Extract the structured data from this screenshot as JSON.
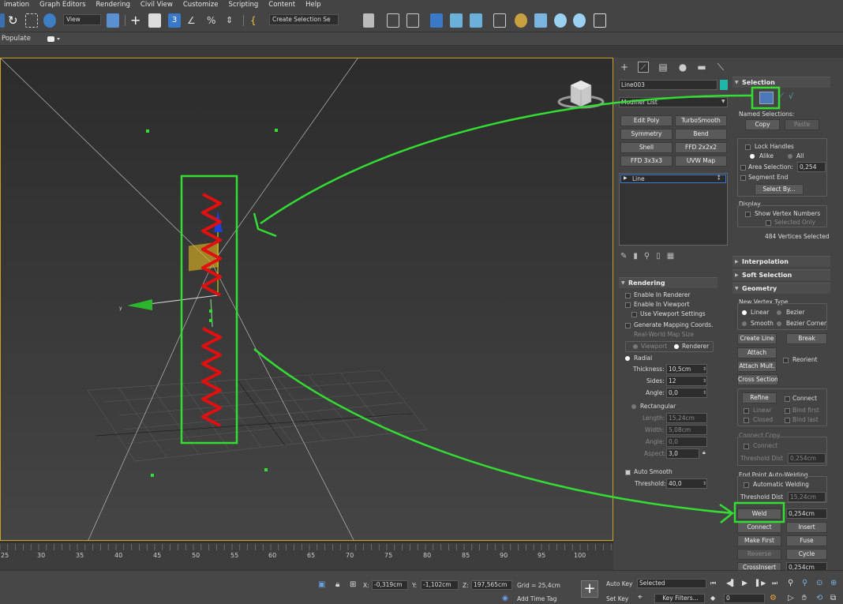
{
  "menu": [
    "imation",
    "Graph Editors",
    "Rendering",
    "Civil View",
    "Customize",
    "Scripting",
    "Content",
    "Help"
  ],
  "toolbar": {
    "view_dropdown": "View",
    "selection_set_dropdown": "Create Selection Se"
  },
  "ribbon": {
    "label": "Populate"
  },
  "object_name": "Line003",
  "modifier_list": {
    "label": "Modifier List",
    "buttons": [
      "Edit Poly",
      "TurboSmooth",
      "Symmetry",
      "Bend",
      "Shell",
      "FFD 2x2x2",
      "FFD 3x3x3",
      "UVW Map"
    ],
    "stack_item": "Line"
  },
  "rendering": {
    "title": "Rendering",
    "enable_renderer": "Enable In Renderer",
    "enable_viewport": "Enable In Viewport",
    "use_viewport": "Use Viewport Settings",
    "gen_mapping": "Generate Mapping Coords.",
    "realworld": "Real-World Map Size",
    "viewport": "Viewport",
    "renderer": "Renderer",
    "radial": "Radial",
    "thickness_label": "Thickness:",
    "thickness": "10,5cm",
    "sides_label": "Sides:",
    "sides": "12",
    "angle_label": "Angle:",
    "angle": "0,0",
    "rectangular": "Rectangular",
    "length_label": "Length:",
    "length": "15,24cm",
    "width_label": "Width:",
    "width": "5,08cm",
    "angle2_label": "Angle:",
    "angle2": "0,0",
    "aspect_label": "Aspect:",
    "aspect": "3,0",
    "auto_smooth": "Auto Smooth",
    "threshold_label": "Threshold:",
    "threshold": "40,0"
  },
  "selection": {
    "title": "Selection",
    "named_selections": "Named Selections:",
    "copy": "Copy",
    "paste": "Paste",
    "lock_handles": "Lock Handles",
    "alike": "Alike",
    "all": "All",
    "area_selection": "Area Selection:",
    "area_value": "0,254",
    "segment_end": "Segment End",
    "select_by": "Select By...",
    "display": "Display",
    "show_vertex_numbers": "Show Vertex Numbers",
    "selected_only": "Selected Only",
    "vertices_selected": "484 Vertices Selected"
  },
  "interpolation": {
    "title": "Interpolation"
  },
  "soft_selection": {
    "title": "Soft Selection"
  },
  "geometry": {
    "title": "Geometry",
    "new_vertex_type": "New Vertex Type",
    "linear": "Linear",
    "bezier": "Bezier",
    "smooth": "Smooth",
    "bezier_corner": "Bezier Corner",
    "create_line": "Create Line",
    "break": "Break",
    "attach": "Attach",
    "reorient": "Reorient",
    "attach_mult": "Attach Mult.",
    "cross_section": "Cross Section",
    "refine": "Refine",
    "connect": "Connect",
    "linear2": "Linear",
    "bind_first": "Bind first",
    "closed": "Closed",
    "bind_last": "Bind last",
    "connect_copy": "Connect Copy",
    "connect2": "Connect",
    "threshold_dist": "Threshold Dist",
    "threshold_dist_value": "0,254cm",
    "end_point_auto_welding": "End Point Auto-Welding",
    "automatic_welding": "Automatic Welding",
    "threshold_dist2": "Threshold Dist",
    "threshold_dist2_value": "15,24cm",
    "weld": "Weld",
    "weld_value": "0,254cm",
    "connect_btn": "Connect",
    "insert": "Insert",
    "make_first": "Make First",
    "fuse": "Fuse",
    "reverse": "Reverse",
    "cycle": "Cycle",
    "cross_insert": "CrossInsert",
    "cross_insert_value": "0,254cm"
  },
  "timeline": {
    "ticks": [
      "25",
      "30",
      "35",
      "40",
      "45",
      "50",
      "55",
      "60",
      "65",
      "70",
      "75",
      "80",
      "85",
      "90",
      "95",
      "100"
    ]
  },
  "status": {
    "x_label": "X:",
    "x": "-0,319cm",
    "y_label": "Y:",
    "y": "-1,102cm",
    "z_label": "Z:",
    "z": "197,565cm",
    "grid": "Grid = 25,4cm",
    "add_time_tag": "Add Time Tag",
    "auto_key": "Auto Key",
    "selected": "Selected",
    "set_key": "Set Key",
    "key_filters": "Key Filters...",
    "frame": "0"
  },
  "colors": {
    "highlight": "#33dd33",
    "helix": "#e01010",
    "object_color": "#1fb8a8",
    "viewport_border": "#c9a227"
  }
}
